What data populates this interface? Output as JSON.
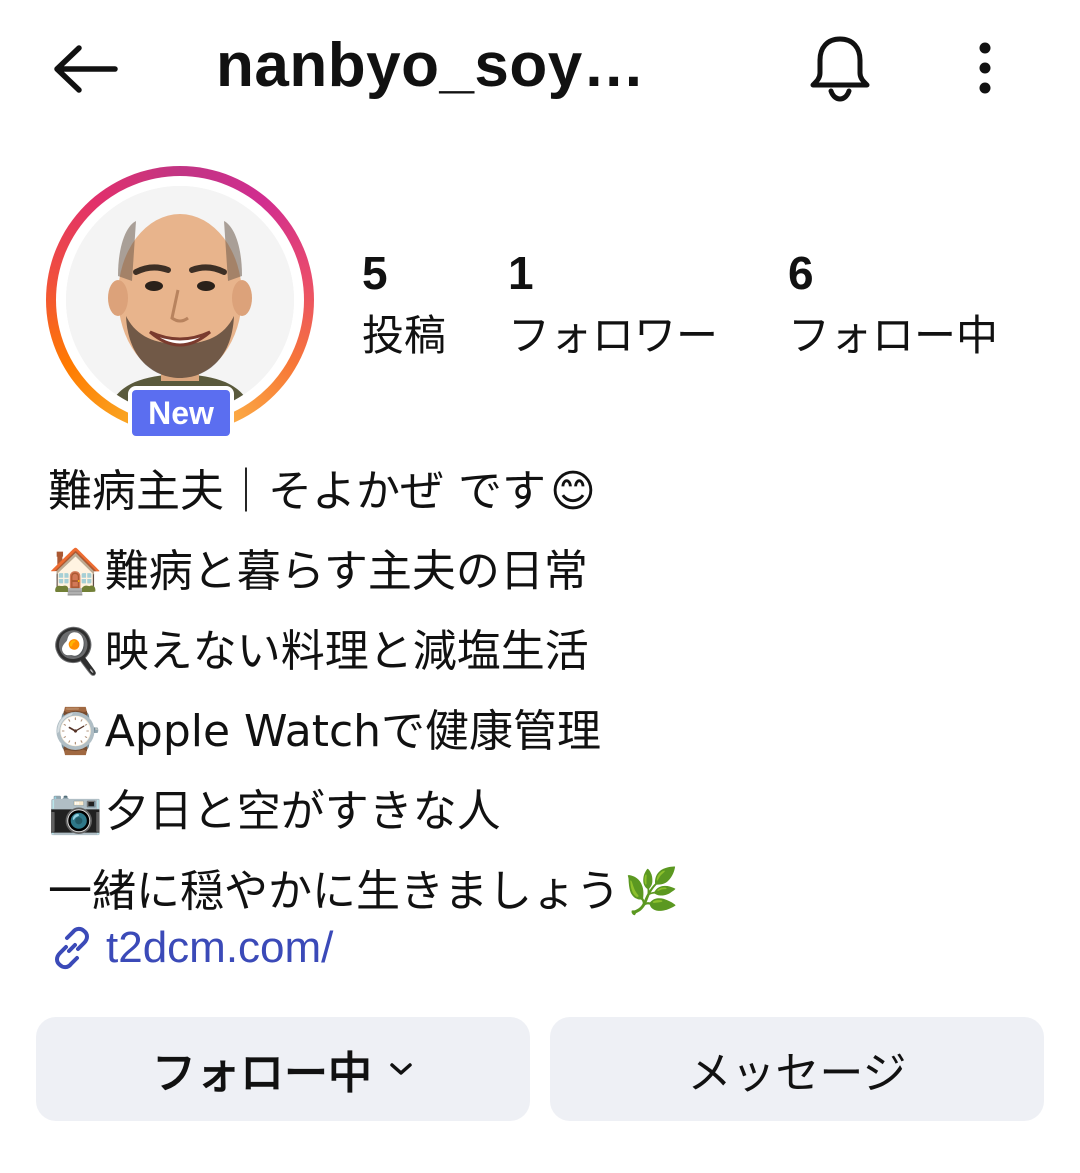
{
  "header": {
    "username": "nanbyo_soy…",
    "back_icon": "arrow-left-icon",
    "notification_icon": "bell-icon",
    "more_icon": "more-vertical-icon"
  },
  "profile": {
    "avatar_badge": "New",
    "stats": [
      {
        "value": "5",
        "label": "投稿"
      },
      {
        "value": "1",
        "label": "フォロワー"
      },
      {
        "value": "6",
        "label": "フォロー中"
      }
    ]
  },
  "bio": {
    "lines": [
      {
        "emoji_before": "",
        "text": "難病主夫｜そよかぜ です",
        "emoji_after": "😊"
      },
      {
        "emoji_before": "🏠",
        "text": "難病と暮らす主夫の日常",
        "emoji_after": ""
      },
      {
        "emoji_before": "🍳",
        "text": "映えない料理と減塩生活",
        "emoji_after": ""
      },
      {
        "emoji_before": "⌚",
        "text": "Apple Watchで健康管理",
        "emoji_after": ""
      },
      {
        "emoji_before": "📷",
        "text": "夕日と空がすきな人",
        "emoji_after": ""
      },
      {
        "emoji_before": "",
        "text": "一緒に穏やかに生きましょう",
        "emoji_after": "🌿"
      }
    ],
    "link": "t2dcm.com/"
  },
  "actions": {
    "following_label": "フォロー中",
    "message_label": "メッセージ"
  },
  "colors": {
    "link": "#3b4ab8",
    "badge": "#5b6ef0",
    "button_bg": "#eef0f5"
  }
}
